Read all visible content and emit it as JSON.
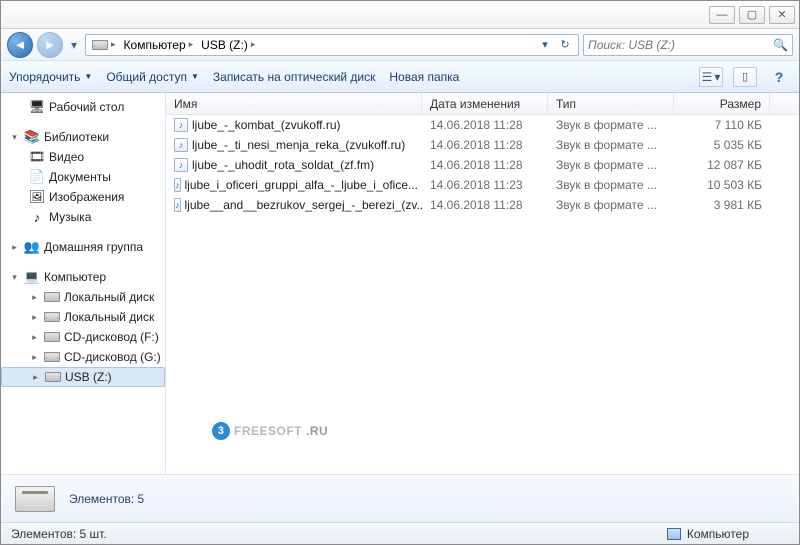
{
  "titlebar": {
    "min": "—",
    "max": "▢",
    "close": "✕"
  },
  "nav": {
    "back": "◄",
    "forward": "►",
    "drop": "▾"
  },
  "breadcrumb": {
    "segments": [
      {
        "label": "Компьютер"
      },
      {
        "label": "USB (Z:)"
      }
    ]
  },
  "address_tools": {
    "dropdown": "▾",
    "refresh": "↻"
  },
  "search": {
    "placeholder": "Поиск: USB (Z:)",
    "icon": "🔍"
  },
  "toolbar": {
    "organize": "Упорядочить",
    "share": "Общий доступ",
    "burn": "Записать на оптический диск",
    "new_folder": "Новая папка",
    "view": "☰",
    "view_arr": "▾",
    "pane": "▯",
    "help": "?"
  },
  "sidebar": {
    "desktop": "Рабочий стол",
    "libraries": "Библиотеки",
    "lib_items": [
      {
        "icon": "🎞",
        "label": "Видео"
      },
      {
        "icon": "📄",
        "label": "Документы"
      },
      {
        "icon": "🖼",
        "label": "Изображения"
      },
      {
        "icon": "♪",
        "label": "Музыка"
      }
    ],
    "homegroup": "Домашняя группа",
    "computer": "Компьютер",
    "drives": [
      {
        "label": "Локальный диск"
      },
      {
        "label": "Локальный диск"
      },
      {
        "label": "CD-дисковод (F:)"
      },
      {
        "label": "CD-дисковод (G:)"
      },
      {
        "label": "USB (Z:)"
      }
    ]
  },
  "columns": {
    "name": "Имя",
    "date": "Дата изменения",
    "type": "Тип",
    "size": "Размер"
  },
  "files": [
    {
      "name": "ljube_-_kombat_(zvukoff.ru)",
      "date": "14.06.2018 11:28",
      "type": "Звук в формате ...",
      "size": "7 110 КБ"
    },
    {
      "name": "ljube_-_ti_nesi_menja_reka_(zvukoff.ru)",
      "date": "14.06.2018 11:28",
      "type": "Звук в формате ...",
      "size": "5 035 КБ"
    },
    {
      "name": "ljube_-_uhodit_rota_soldat_(zf.fm)",
      "date": "14.06.2018 11:28",
      "type": "Звук в формате ...",
      "size": "12 087 КБ"
    },
    {
      "name": "ljube_i_oficeri_gruppi_alfa_-_ljube_i_ofice...",
      "date": "14.06.2018 11:23",
      "type": "Звук в формате ...",
      "size": "10 503 КБ"
    },
    {
      "name": "ljube__and__bezrukov_sergej_-_berezi_(zv...",
      "date": "14.06.2018 11:28",
      "type": "Звук в формате ...",
      "size": "3 981 КБ"
    }
  ],
  "watermark": {
    "badge": "3",
    "text1": "FREESOFT",
    "text2": ".RU"
  },
  "details": {
    "label": "Элементов: 5"
  },
  "status": {
    "left": "Элементов: 5 шт.",
    "right": "Компьютер"
  }
}
